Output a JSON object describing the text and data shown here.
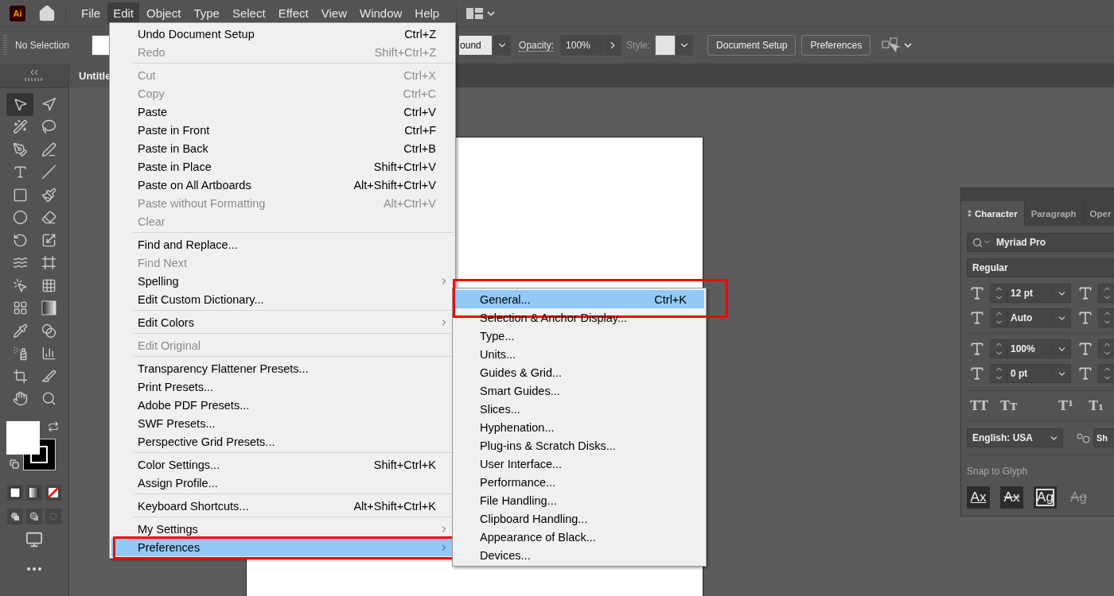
{
  "app_logo": "Ai",
  "menu_bar": [
    {
      "label": "File",
      "selected": false
    },
    {
      "label": "Edit",
      "selected": true
    },
    {
      "label": "Object",
      "selected": false
    },
    {
      "label": "Type",
      "selected": false
    },
    {
      "label": "Select",
      "selected": false
    },
    {
      "label": "Effect",
      "selected": false
    },
    {
      "label": "View",
      "selected": false
    },
    {
      "label": "Window",
      "selected": false
    },
    {
      "label": "Help",
      "selected": false
    }
  ],
  "control_bar": {
    "selection_label": "No Selection",
    "stroke_dropdown": "ound",
    "opacity_label": "Opacity:",
    "opacity_value": "100%",
    "style_label": "Style:",
    "buttons": [
      "Document Setup",
      "Preferences"
    ]
  },
  "document_tab": "Untitle",
  "edit_menu": {
    "items": [
      {
        "kind": "item",
        "label": "Undo Document Setup",
        "shortcut": "Ctrl+Z",
        "disabled": false,
        "submenu": false,
        "selected": false,
        "framed": false
      },
      {
        "kind": "item",
        "label": "Redo",
        "shortcut": "Shift+Ctrl+Z",
        "disabled": true,
        "submenu": false,
        "selected": false,
        "framed": false
      },
      {
        "kind": "separator"
      },
      {
        "kind": "item",
        "label": "Cut",
        "shortcut": "Ctrl+X",
        "disabled": true,
        "submenu": false,
        "selected": false,
        "framed": false
      },
      {
        "kind": "item",
        "label": "Copy",
        "shortcut": "Ctrl+C",
        "disabled": true,
        "submenu": false,
        "selected": false,
        "framed": false
      },
      {
        "kind": "item",
        "label": "Paste",
        "shortcut": "Ctrl+V",
        "disabled": false,
        "submenu": false,
        "selected": false,
        "framed": false
      },
      {
        "kind": "item",
        "label": "Paste in Front",
        "shortcut": "Ctrl+F",
        "disabled": false,
        "submenu": false,
        "selected": false,
        "framed": false
      },
      {
        "kind": "item",
        "label": "Paste in Back",
        "shortcut": "Ctrl+B",
        "disabled": false,
        "submenu": false,
        "selected": false,
        "framed": false
      },
      {
        "kind": "item",
        "label": "Paste in Place",
        "shortcut": "Shift+Ctrl+V",
        "disabled": false,
        "submenu": false,
        "selected": false,
        "framed": false
      },
      {
        "kind": "item",
        "label": "Paste on All Artboards",
        "shortcut": "Alt+Shift+Ctrl+V",
        "disabled": false,
        "submenu": false,
        "selected": false,
        "framed": false
      },
      {
        "kind": "item",
        "label": "Paste without Formatting",
        "shortcut": "Alt+Ctrl+V",
        "disabled": true,
        "submenu": false,
        "selected": false,
        "framed": false
      },
      {
        "kind": "item",
        "label": "Clear",
        "disabled": true,
        "submenu": false,
        "selected": false,
        "framed": false
      },
      {
        "kind": "separator"
      },
      {
        "kind": "item",
        "label": "Find and Replace...",
        "disabled": false,
        "submenu": false,
        "selected": false,
        "framed": false
      },
      {
        "kind": "item",
        "label": "Find Next",
        "disabled": true,
        "submenu": false,
        "selected": false,
        "framed": false
      },
      {
        "kind": "item",
        "label": "Spelling",
        "disabled": false,
        "submenu": true,
        "selected": false,
        "framed": false
      },
      {
        "kind": "item",
        "label": "Edit Custom Dictionary...",
        "disabled": false,
        "submenu": false,
        "selected": false,
        "framed": false
      },
      {
        "kind": "separator"
      },
      {
        "kind": "item",
        "label": "Edit Colors",
        "disabled": false,
        "submenu": true,
        "selected": false,
        "framed": false
      },
      {
        "kind": "separator"
      },
      {
        "kind": "item",
        "label": "Edit Original",
        "disabled": true,
        "submenu": false,
        "selected": false,
        "framed": false
      },
      {
        "kind": "separator"
      },
      {
        "kind": "item",
        "label": "Transparency Flattener Presets...",
        "disabled": false,
        "submenu": false,
        "selected": false,
        "framed": false
      },
      {
        "kind": "item",
        "label": "Print Presets...",
        "disabled": false,
        "submenu": false,
        "selected": false,
        "framed": false
      },
      {
        "kind": "item",
        "label": "Adobe PDF Presets...",
        "disabled": false,
        "submenu": false,
        "selected": false,
        "framed": false
      },
      {
        "kind": "item",
        "label": "SWF Presets...",
        "disabled": false,
        "submenu": false,
        "selected": false,
        "framed": false
      },
      {
        "kind": "item",
        "label": "Perspective Grid Presets...",
        "disabled": false,
        "submenu": false,
        "selected": false,
        "framed": false
      },
      {
        "kind": "separator"
      },
      {
        "kind": "item",
        "label": "Color Settings...",
        "shortcut": "Shift+Ctrl+K",
        "disabled": false,
        "submenu": false,
        "selected": false,
        "framed": false
      },
      {
        "kind": "item",
        "label": "Assign Profile...",
        "disabled": false,
        "submenu": false,
        "selected": false,
        "framed": false
      },
      {
        "kind": "separator"
      },
      {
        "kind": "item",
        "label": "Keyboard Shortcuts...",
        "shortcut": "Alt+Shift+Ctrl+K",
        "disabled": false,
        "submenu": false,
        "selected": false,
        "framed": false
      },
      {
        "kind": "separator"
      },
      {
        "kind": "item",
        "label": "My Settings",
        "disabled": false,
        "submenu": true,
        "selected": false,
        "framed": false
      },
      {
        "kind": "item",
        "label": "Preferences",
        "disabled": false,
        "submenu": true,
        "selected": true,
        "framed": true
      }
    ]
  },
  "preferences_submenu": {
    "items": [
      {
        "kind": "item",
        "label": "General...",
        "shortcut": "Ctrl+K",
        "disabled": false,
        "submenu": false,
        "selected": true,
        "framed": true
      },
      {
        "kind": "item",
        "label": "Selection & Anchor Display...",
        "disabled": false,
        "submenu": false,
        "selected": false,
        "framed": false
      },
      {
        "kind": "item",
        "label": "Type...",
        "disabled": false,
        "submenu": false,
        "selected": false,
        "framed": false
      },
      {
        "kind": "item",
        "label": "Units...",
        "disabled": false,
        "submenu": false,
        "selected": false,
        "framed": false
      },
      {
        "kind": "item",
        "label": "Guides & Grid...",
        "disabled": false,
        "submenu": false,
        "selected": false,
        "framed": false
      },
      {
        "kind": "item",
        "label": "Smart Guides...",
        "disabled": false,
        "submenu": false,
        "selected": false,
        "framed": false
      },
      {
        "kind": "item",
        "label": "Slices...",
        "disabled": false,
        "submenu": false,
        "selected": false,
        "framed": false
      },
      {
        "kind": "item",
        "label": "Hyphenation...",
        "disabled": false,
        "submenu": false,
        "selected": false,
        "framed": false
      },
      {
        "kind": "item",
        "label": "Plug-ins & Scratch Disks...",
        "disabled": false,
        "submenu": false,
        "selected": false,
        "framed": false
      },
      {
        "kind": "item",
        "label": "User Interface...",
        "disabled": false,
        "submenu": false,
        "selected": false,
        "framed": false
      },
      {
        "kind": "item",
        "label": "Performance...",
        "disabled": false,
        "submenu": false,
        "selected": false,
        "framed": false
      },
      {
        "kind": "item",
        "label": "File Handling...",
        "disabled": false,
        "submenu": false,
        "selected": false,
        "framed": false
      },
      {
        "kind": "item",
        "label": "Clipboard Handling...",
        "disabled": false,
        "submenu": false,
        "selected": false,
        "framed": false
      },
      {
        "kind": "item",
        "label": "Appearance of Black...",
        "disabled": false,
        "submenu": false,
        "selected": false,
        "framed": false
      },
      {
        "kind": "item",
        "label": "Devices...",
        "disabled": false,
        "submenu": false,
        "selected": false,
        "framed": false
      }
    ]
  },
  "tools": [
    {
      "selected": true
    },
    {
      "selected": false
    }
  ],
  "character_panel": {
    "tabs": [
      {
        "label": "Character",
        "selected": true
      },
      {
        "label": "Paragraph",
        "selected": false
      },
      {
        "label": "Oper",
        "selected": false
      }
    ],
    "font_family": "Myriad Pro",
    "font_style": "Regular",
    "fields": [
      {
        "value": "12 pt"
      },
      {
        "value": "Auto"
      },
      {
        "value": "100%"
      },
      {
        "value": "0 pt"
      }
    ],
    "type_buttons": [
      "TT",
      "Tᴛ",
      "T¹",
      "T₁"
    ],
    "language": "English: USA",
    "anti_aliasing": "Sh",
    "snap_label": "Snap to Glyph",
    "snap_buttons": [
      {
        "label": "Ax",
        "kind": "underline"
      },
      {
        "label": "Ax",
        "kind": "strike"
      },
      {
        "label": "Ag",
        "kind": "boxed"
      },
      {
        "label": "Ag",
        "kind": "faint"
      }
    ]
  }
}
